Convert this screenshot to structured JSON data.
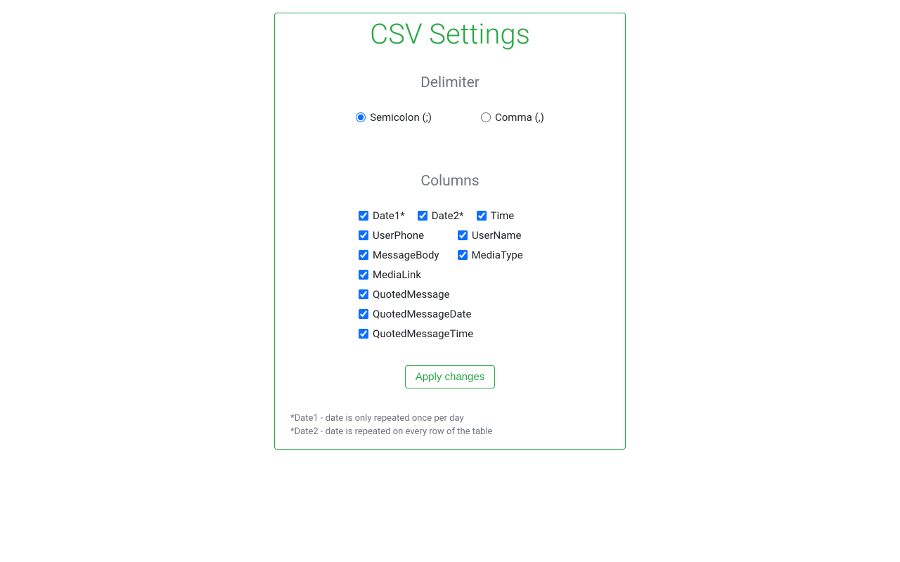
{
  "title": "CSV Settings",
  "delimiter": {
    "heading": "Delimiter",
    "options": [
      {
        "label": "Semicolon (;)",
        "checked": true
      },
      {
        "label": "Comma (,)",
        "checked": false
      }
    ]
  },
  "columns": {
    "heading": "Columns",
    "rows": [
      [
        {
          "label": "Date1*",
          "checked": true
        },
        {
          "label": "Date2*",
          "checked": true
        },
        {
          "label": "Time",
          "checked": true
        }
      ],
      [
        {
          "label": "UserPhone",
          "checked": true
        },
        {
          "label": "UserName",
          "checked": true
        }
      ],
      [
        {
          "label": "MessageBody",
          "checked": true
        },
        {
          "label": "MediaType",
          "checked": true
        }
      ],
      [
        {
          "label": "MediaLink",
          "checked": true
        }
      ],
      [
        {
          "label": "QuotedMessage",
          "checked": true
        }
      ],
      [
        {
          "label": "QuotedMessageDate",
          "checked": true
        }
      ],
      [
        {
          "label": "QuotedMessageTime",
          "checked": true
        }
      ]
    ]
  },
  "apply_label": "Apply changes",
  "footnotes": [
    "*Date1 - date is only repeated once per day",
    "*Date2 - date is repeated on every row of the table"
  ]
}
